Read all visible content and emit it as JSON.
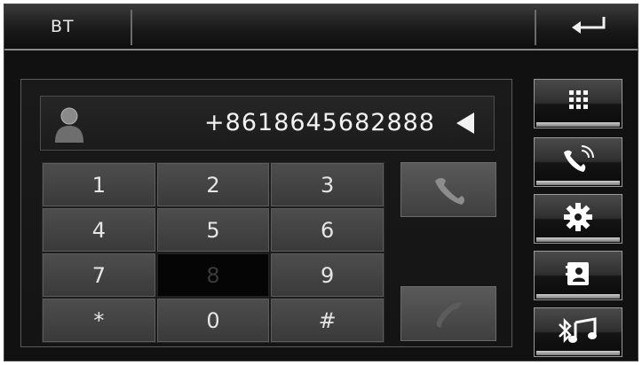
{
  "header": {
    "title": "BT",
    "back_icon": "return-arrow-icon"
  },
  "display": {
    "contact_icon": "contact-avatar-icon",
    "number": "+8618645682888",
    "backspace_icon": "backspace-triangle-icon"
  },
  "keypad": {
    "keys": [
      "1",
      "2",
      "3",
      "4",
      "5",
      "6",
      "7",
      "8",
      "9",
      "*",
      "0",
      "#"
    ],
    "pressed_key": "8"
  },
  "call_buttons": {
    "dial_icon": "phone-call-icon",
    "hangup_icon": "phone-hangup-icon"
  },
  "side_menu": [
    {
      "icon": "keypad-grid-icon"
    },
    {
      "icon": "phone-ringing-icon"
    },
    {
      "icon": "gear-icon"
    },
    {
      "icon": "contacts-book-icon"
    },
    {
      "icon": "bluetooth-music-icon"
    }
  ]
}
